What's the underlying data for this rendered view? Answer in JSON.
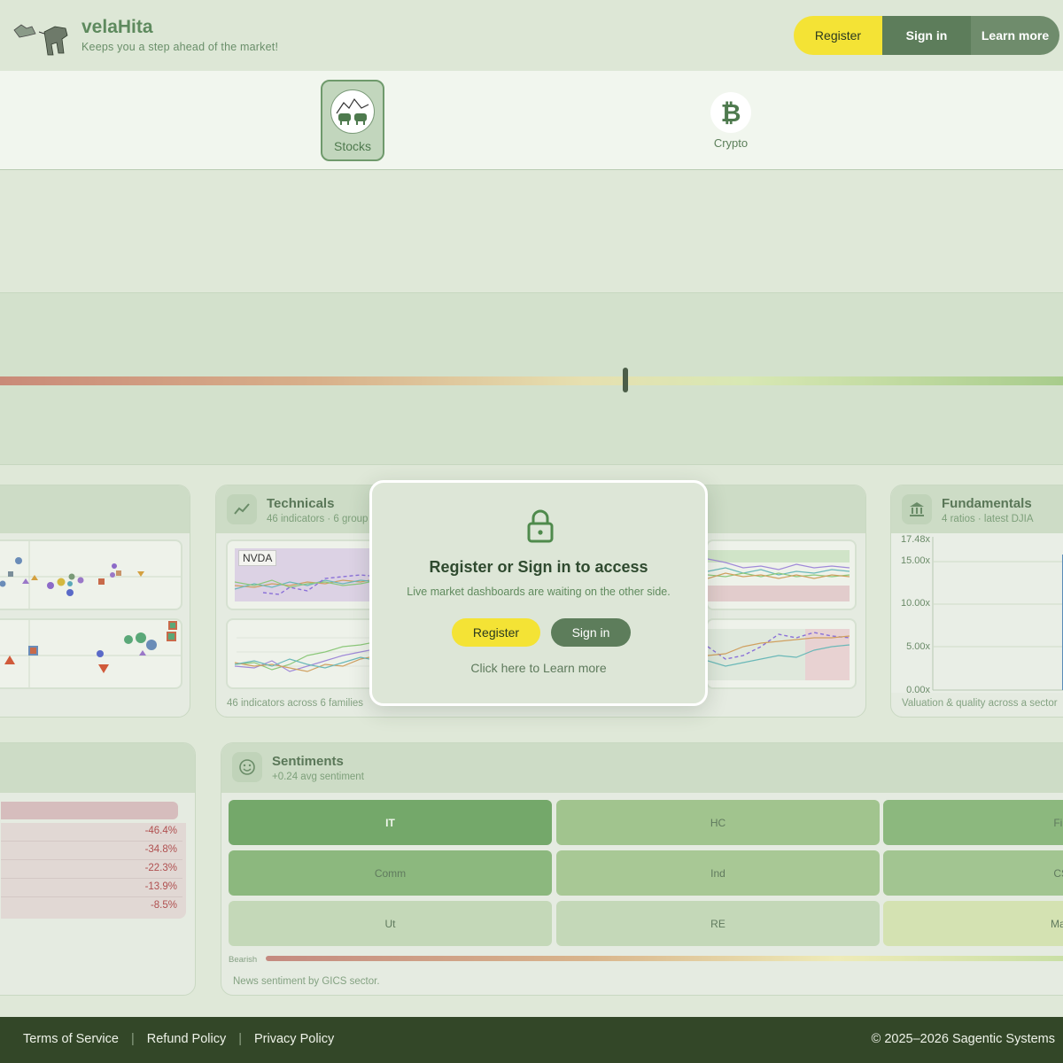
{
  "header": {
    "brand_name": "velaHita",
    "tagline": "Keeps you a step ahead of the market!",
    "register_label": "Register",
    "signin_label": "Sign in",
    "learn_label": "Learn more"
  },
  "nav": {
    "items": [
      {
        "label": "Stocks",
        "icon": "bull-bear-icon",
        "active": true
      },
      {
        "label": "Crypto",
        "icon": "bitcoin-icon",
        "active": false
      }
    ]
  },
  "gauge": {
    "level": 0.588
  },
  "technicals": {
    "title": "Technicals",
    "subtitle": "46 indicators · 6 group",
    "ticker": "NVDA",
    "footer": "46 indicators across 6 families"
  },
  "fundamentals": {
    "title": "Fundamentals",
    "subtitle": "4 ratios · latest DJIA",
    "y_ticks": [
      "17.48x",
      "15.00x",
      "10.00x",
      "5.00x",
      "0.00x"
    ],
    "footer": "Valuation & quality across a sector"
  },
  "movers": {
    "values": [
      "-46.4%",
      "-34.8%",
      "-22.3%",
      "-13.9%",
      "-8.5%"
    ]
  },
  "sentiments": {
    "title": "Sentiments",
    "subtitle": "+0.24 avg sentiment",
    "sectors": [
      {
        "label": "IT",
        "color": "#74a86a"
      },
      {
        "label": "HC",
        "color": "#a1c48e"
      },
      {
        "label": "Fin",
        "color": "#8cb87e"
      },
      {
        "label": "Comm",
        "color": "#8cb87e"
      },
      {
        "label": "Ind",
        "color": "#a8c895"
      },
      {
        "label": "CS",
        "color": "#a2c591"
      },
      {
        "label": "Ut",
        "color": "#c4d8b8"
      },
      {
        "label": "RE",
        "color": "#c4d8b8"
      },
      {
        "label": "Mat",
        "color": "#d4e2b2"
      }
    ],
    "scale_label": "Bearish",
    "footer": "News sentiment by GICS sector."
  },
  "modal": {
    "title": "Register or Sign in to access",
    "text": "Live market dashboards are waiting on the other side.",
    "register_label": "Register",
    "signin_label": "Sign in",
    "learn_label": "Click here to Learn more"
  },
  "footer": {
    "links": [
      "Terms of Service",
      "Refund Policy",
      "Privacy Policy"
    ],
    "copyright": "© 2025–2026 Sagentic Systems"
  }
}
